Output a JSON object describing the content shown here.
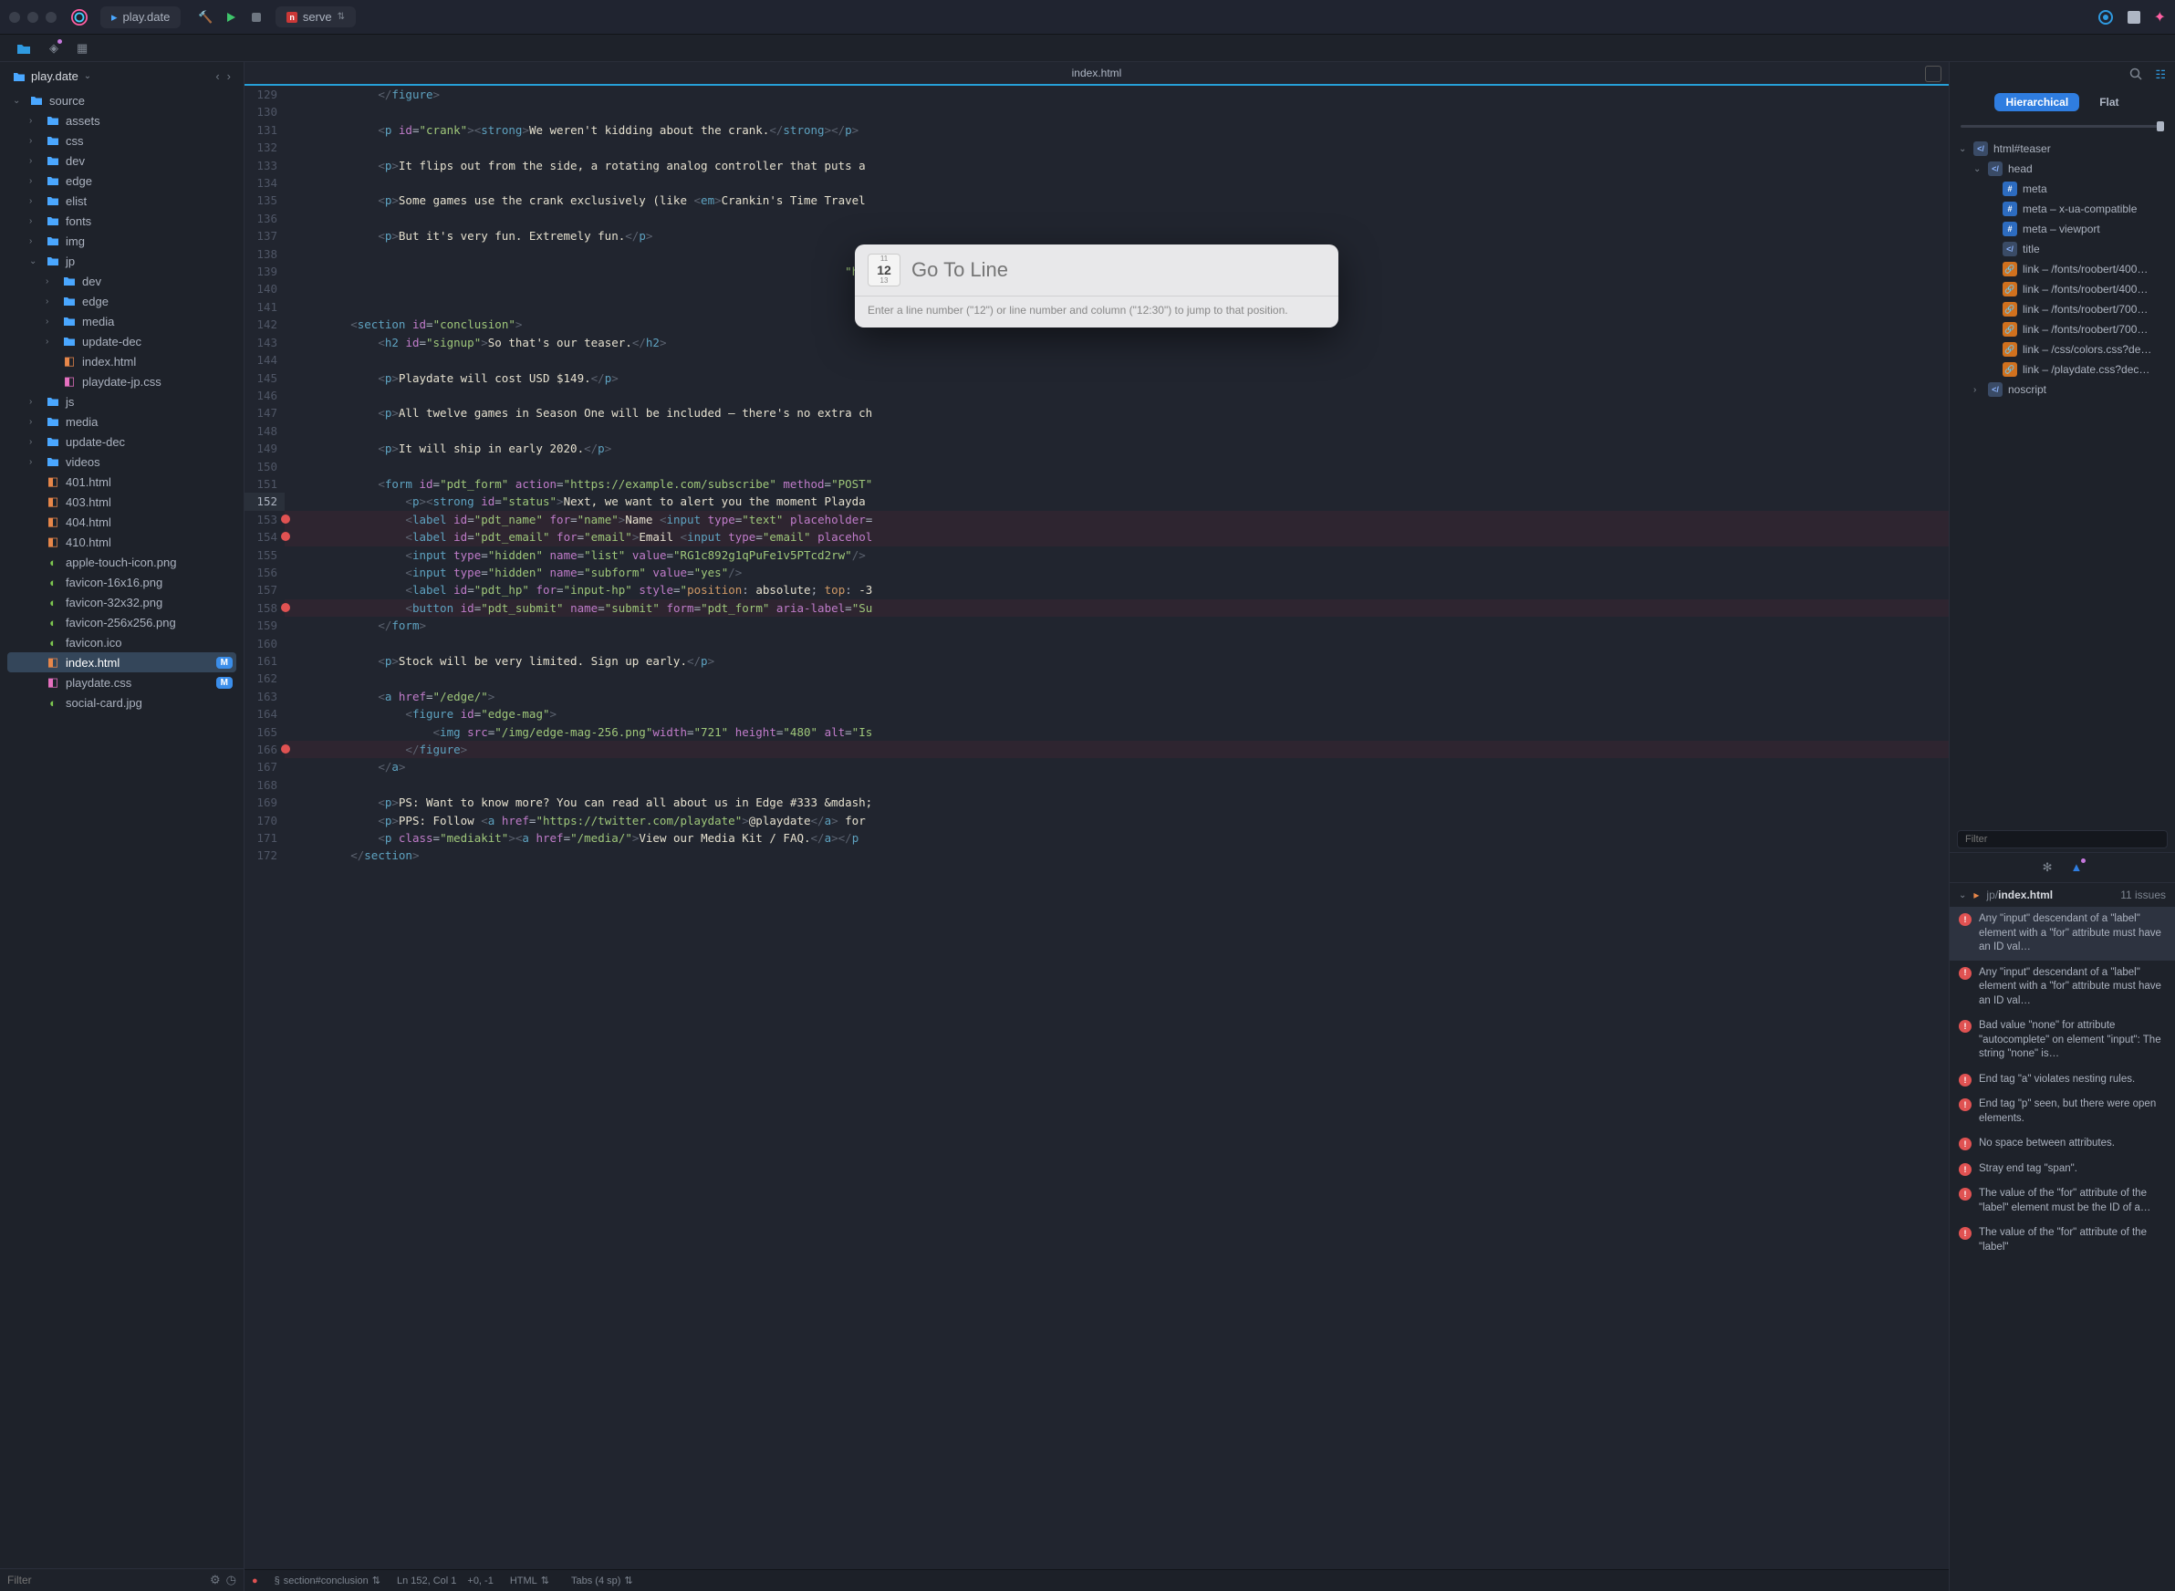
{
  "toolbar": {
    "tab_title": "play.date",
    "run_config": "serve",
    "run_icons": [
      "build",
      "run",
      "stop"
    ]
  },
  "sidebar": {
    "project": "play.date",
    "filter_placeholder": "Filter",
    "tree": [
      {
        "d": 0,
        "t": "folder",
        "open": true,
        "label": "source"
      },
      {
        "d": 1,
        "t": "folder",
        "label": "assets"
      },
      {
        "d": 1,
        "t": "folder",
        "label": "css"
      },
      {
        "d": 1,
        "t": "folder",
        "label": "dev"
      },
      {
        "d": 1,
        "t": "folder",
        "label": "edge"
      },
      {
        "d": 1,
        "t": "folder",
        "label": "elist"
      },
      {
        "d": 1,
        "t": "folder",
        "label": "fonts"
      },
      {
        "d": 1,
        "t": "folder",
        "label": "img"
      },
      {
        "d": 1,
        "t": "folder",
        "open": true,
        "label": "jp"
      },
      {
        "d": 2,
        "t": "folder",
        "label": "dev"
      },
      {
        "d": 2,
        "t": "folder",
        "label": "edge"
      },
      {
        "d": 2,
        "t": "folder",
        "label": "media"
      },
      {
        "d": 2,
        "t": "folder",
        "label": "update-dec"
      },
      {
        "d": 2,
        "t": "file",
        "icon": "html",
        "label": "index.html"
      },
      {
        "d": 2,
        "t": "file",
        "icon": "css",
        "label": "playdate-jp.css"
      },
      {
        "d": 1,
        "t": "folder",
        "label": "js"
      },
      {
        "d": 1,
        "t": "folder",
        "label": "media"
      },
      {
        "d": 1,
        "t": "folder",
        "label": "update-dec"
      },
      {
        "d": 1,
        "t": "folder",
        "label": "videos"
      },
      {
        "d": 1,
        "t": "file",
        "icon": "html",
        "label": "401.html"
      },
      {
        "d": 1,
        "t": "file",
        "icon": "html",
        "label": "403.html"
      },
      {
        "d": 1,
        "t": "file",
        "icon": "html",
        "label": "404.html"
      },
      {
        "d": 1,
        "t": "file",
        "icon": "html",
        "label": "410.html"
      },
      {
        "d": 1,
        "t": "file",
        "icon": "img",
        "label": "apple-touch-icon.png"
      },
      {
        "d": 1,
        "t": "file",
        "icon": "img",
        "label": "favicon-16x16.png"
      },
      {
        "d": 1,
        "t": "file",
        "icon": "img",
        "label": "favicon-32x32.png"
      },
      {
        "d": 1,
        "t": "file",
        "icon": "img",
        "label": "favicon-256x256.png"
      },
      {
        "d": 1,
        "t": "file",
        "icon": "img",
        "label": "favicon.ico"
      },
      {
        "d": 1,
        "t": "file",
        "icon": "html",
        "label": "index.html",
        "selected": true,
        "badge": "M"
      },
      {
        "d": 1,
        "t": "file",
        "icon": "css",
        "label": "playdate.css",
        "badge": "M"
      },
      {
        "d": 1,
        "t": "file",
        "icon": "img",
        "label": "social-card.jpg"
      }
    ]
  },
  "editor": {
    "tab": "index.html",
    "first_line": 129,
    "errors_at": [
      153,
      154,
      158,
      166
    ],
    "selected_line": 152
  },
  "goto": {
    "placeholder": "Go To Line",
    "hint": "Enter a line number (\"12\") or line number and column (\"12:30\") to jump to that position."
  },
  "statusbar": {
    "symbol": "section#conclusion",
    "position": "Ln 152, Col 1",
    "offset": "+0, -1",
    "lang": "HTML",
    "indent": "Tabs (4 sp)"
  },
  "dom": {
    "tab_a": "Hierarchical",
    "tab_b": "Flat",
    "filter_placeholder": "Filter",
    "items": [
      {
        "d": 0,
        "icon": "tag",
        "chev": "down",
        "label": "html#teaser"
      },
      {
        "d": 1,
        "icon": "tag",
        "chev": "down",
        "label": "head"
      },
      {
        "d": 2,
        "icon": "meta",
        "label": "meta"
      },
      {
        "d": 2,
        "icon": "meta",
        "label": "meta – x-ua-compatible"
      },
      {
        "d": 2,
        "icon": "meta",
        "label": "meta – viewport"
      },
      {
        "d": 2,
        "icon": "tag",
        "label": "title"
      },
      {
        "d": 2,
        "icon": "link",
        "label": "link – /fonts/roobert/400…"
      },
      {
        "d": 2,
        "icon": "link",
        "label": "link – /fonts/roobert/400…"
      },
      {
        "d": 2,
        "icon": "link",
        "label": "link – /fonts/roobert/700…"
      },
      {
        "d": 2,
        "icon": "link",
        "label": "link – /fonts/roobert/700…"
      },
      {
        "d": 2,
        "icon": "link",
        "label": "link – /css/colors.css?de…"
      },
      {
        "d": 2,
        "icon": "link",
        "label": "link – /playdate.css?dec…"
      },
      {
        "d": 1,
        "icon": "tag",
        "chev": "right",
        "label": "noscript"
      }
    ]
  },
  "issues": {
    "file": "jp/index.html",
    "count": "11 issues",
    "list": [
      "Any \"input\" descendant of a \"label\" element with a \"for\" attribute must have an ID val…",
      "Any \"input\" descendant of a \"label\" element with a \"for\" attribute must have an ID val…",
      "Bad value \"none\" for attribute \"autocomplete\" on element \"input\": The string \"none\" is…",
      "End tag \"a\" violates nesting rules.",
      "End tag \"p\" seen, but there were open elements.",
      "No space between attributes.",
      "Stray end tag \"span\".",
      "The value of the \"for\" attribute of the \"label\" element must be the ID of a…",
      "The value of the \"for\" attribute of the \"label\""
    ]
  }
}
